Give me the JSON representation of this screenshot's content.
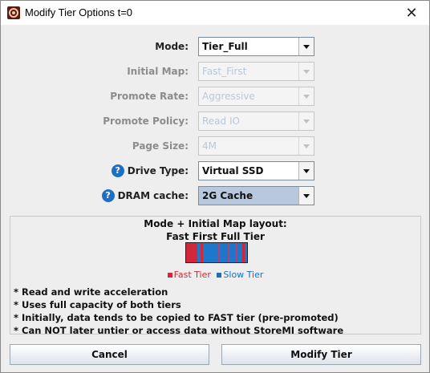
{
  "window": {
    "title": "Modify Tier Options t=0",
    "close_glyph": "✕",
    "icon": "app-logo-icon"
  },
  "form": {
    "mode": {
      "label": "Mode:",
      "value": "Tier_Full",
      "enabled": true
    },
    "initial_map": {
      "label": "Initial Map:",
      "value": "Fast_First",
      "enabled": false
    },
    "promote_rate": {
      "label": "Promote Rate:",
      "value": "Aggressive",
      "enabled": false
    },
    "promote_policy": {
      "label": "Promote Policy:",
      "value": "Read IO",
      "enabled": false
    },
    "page_size": {
      "label": "Page Size:",
      "value": "4M",
      "enabled": false
    },
    "drive_type": {
      "label": "Drive Type:",
      "value": "Virtual SSD",
      "enabled": true,
      "help_glyph": "?"
    },
    "dram_cache": {
      "label": "DRAM cache:",
      "value": "2G Cache",
      "enabled": true,
      "selected": true,
      "help_glyph": "?"
    }
  },
  "layout_panel": {
    "heading": "Mode + Initial Map layout:",
    "subheading": "Fast First Full Tier",
    "map_colors": {
      "fast": "#d0283a",
      "slow": "#1d78cc"
    },
    "legend": {
      "fast_label": "Fast Tier",
      "slow_label": "Slow Tier"
    },
    "bullets": [
      "* Read and write acceleration",
      "* Uses full capacity of both tiers",
      "* Initially, data tends to be copied to FAST tier (pre-promoted)",
      "* Can NOT later untier or access data without StoreMI software"
    ]
  },
  "buttons": {
    "cancel": "Cancel",
    "modify": "Modify Tier"
  }
}
